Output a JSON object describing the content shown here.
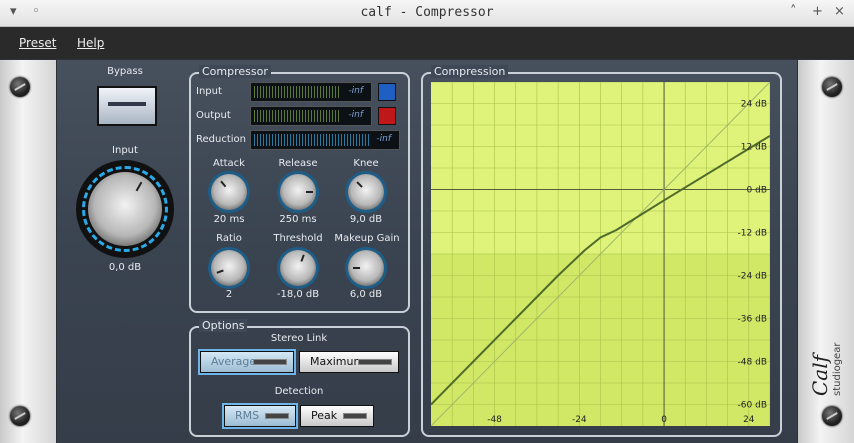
{
  "window": {
    "title": "calf - Compressor"
  },
  "menu": {
    "preset": "Preset",
    "help": "Help"
  },
  "left": {
    "bypass_label": "Bypass",
    "input_label": "Input",
    "input_value": "0,0 dB"
  },
  "compressor": {
    "title": "Compressor",
    "meters": [
      {
        "label": "Input",
        "value": "-inf"
      },
      {
        "label": "Output",
        "value": "-inf"
      },
      {
        "label": "Reduction",
        "value": "-inf"
      }
    ],
    "knobs": [
      {
        "label": "Attack",
        "value": "20 ms"
      },
      {
        "label": "Release",
        "value": "250 ms"
      },
      {
        "label": "Knee",
        "value": "9,0 dB"
      },
      {
        "label": "Ratio",
        "value": "2"
      },
      {
        "label": "Threshold",
        "value": "-18,0 dB"
      },
      {
        "label": "Makeup Gain",
        "value": "6,0 dB"
      }
    ]
  },
  "options": {
    "title": "Options",
    "stereo_link_label": "Stereo Link",
    "average": "Average",
    "maximum": "Maximum",
    "detection_label": "Detection",
    "rms": "RMS",
    "peak": "Peak"
  },
  "compression": {
    "title": "Compression",
    "y_ticks": [
      "24 dB",
      "12 dB",
      "0 dB",
      "-12 dB",
      "-24 dB",
      "-36 dB",
      "-48 dB",
      "-60 dB"
    ],
    "x_ticks": [
      "-48",
      "-24",
      "0",
      "24"
    ]
  },
  "chart_data": {
    "type": "line",
    "title": "Compression",
    "xlabel": "",
    "ylabel": "",
    "xlim": [
      -66,
      30
    ],
    "ylim": [
      -66,
      30
    ],
    "threshold": -18,
    "ratio": 2,
    "knee": 9,
    "makeup": 6,
    "series": [
      {
        "x": [
          -66,
          30
        ],
        "y": [
          -66,
          30
        ]
      },
      {
        "x": [
          -66,
          -30,
          -22.5,
          -18,
          -13.5,
          0,
          30
        ],
        "y": [
          -60,
          -24,
          -17.0,
          -13.4,
          -11.3,
          -3,
          15
        ]
      }
    ]
  },
  "colors": {
    "graph_bg": "#dff37a",
    "graph_grid": "#a8c04a",
    "curve": "#4e6b2a",
    "ref_line": "#9fb66b",
    "led_blue": "#1f5fc4",
    "led_red": "#c01818"
  },
  "brand": {
    "name": "Calf",
    "sub": "studiogear"
  }
}
